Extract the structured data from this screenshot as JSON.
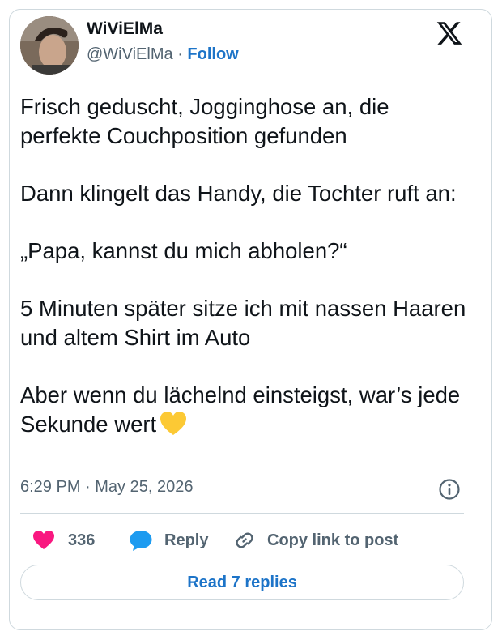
{
  "author": {
    "name": "WiViElMa",
    "handle": "@WiViElMa",
    "separator": "·",
    "follow_label": "Follow"
  },
  "tweet": {
    "paragraphs": [
      "Frisch geduscht, Jogginghose an, die perfekte Couchposition gefunden",
      "Dann klingelt das Handy, die Tochter ruft an:",
      "„Papa, kannst du mich abholen?“",
      "5 Minuten später sitze ich mit nassen Haaren und altem Shirt im Auto",
      "Aber wenn du lächelnd einsteigst, war’s jede Sekunde wert"
    ],
    "trailing_emoji": "yellow-heart"
  },
  "meta": {
    "timestamp": "6:29 PM · May 25, 2026"
  },
  "actions": {
    "like_count": "336",
    "reply_label": "Reply",
    "copy_label": "Copy link to post"
  },
  "read_replies_label": "Read 7 replies",
  "icons": {
    "logo": "x-logo-icon",
    "info": "info-icon",
    "like": "heart-icon",
    "reply": "speech-bubble-icon",
    "copy": "link-icon"
  },
  "colors": {
    "like": "#f91880",
    "reply": "#1d9bf0",
    "link": "#1d74c8",
    "secondary_text": "#536471",
    "emoji_heart": "#fcc934"
  }
}
